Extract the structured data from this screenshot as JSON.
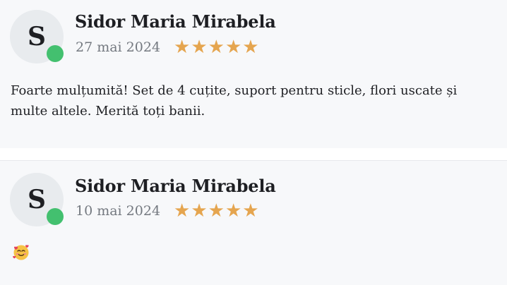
{
  "reviews": [
    {
      "avatar_letter": "S",
      "author": "Sidor Maria Mirabela",
      "date": "27 mai 2024",
      "rating": 5,
      "stars": [
        "★",
        "★",
        "★",
        "★",
        "★"
      ],
      "text": "Foarte mulțumită! Set de 4 cuțite, suport pentru sticle, flori uscate și multe altele. Merită toți banii.",
      "online_color": "#43c06f",
      "star_color": "#e5a54f"
    },
    {
      "avatar_letter": "S",
      "author": "Sidor Maria Mirabela",
      "date": "10 mai 2024",
      "rating": 5,
      "stars": [
        "★",
        "★",
        "★",
        "★",
        "★"
      ],
      "emoji": "smiling-face-with-hearts-icon"
    }
  ]
}
